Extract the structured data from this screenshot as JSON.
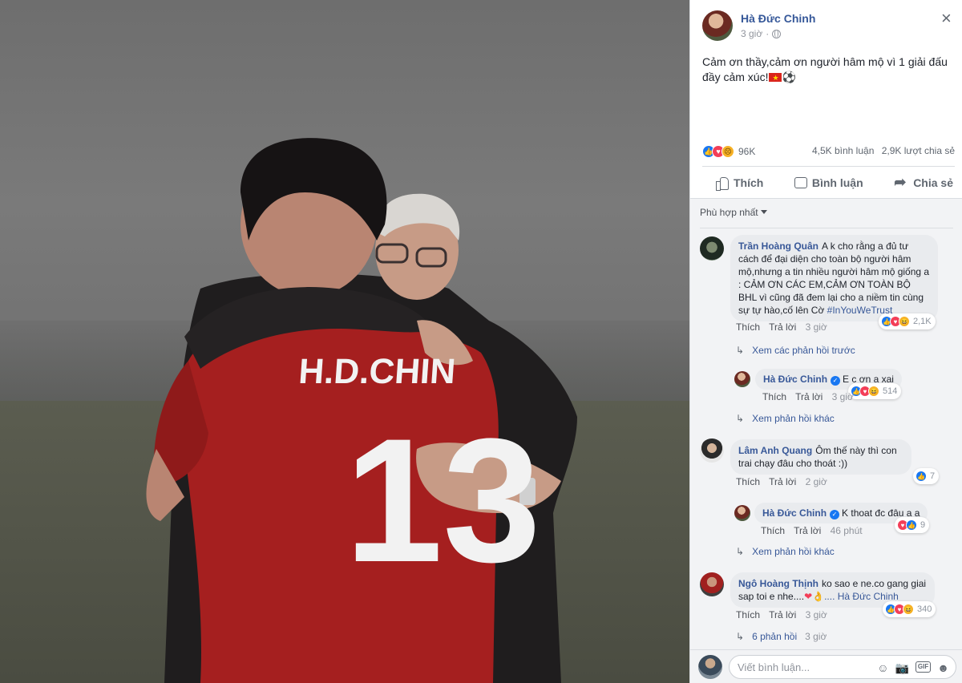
{
  "post": {
    "author": "Hà Đức Chinh",
    "time": "3 giờ",
    "text": "Cảm ơn thầy,cảm ơn người hâm mộ vì 1 giải đấu đầy cảm xúc!",
    "text_emoji_tail": "⚽",
    "reaction_count": "96K",
    "comments_count": "4,5K bình luận",
    "shares_count": "2,9K lượt chia sẻ",
    "actions": {
      "like": "Thích",
      "comment": "Bình luận",
      "share": "Chia sẻ"
    },
    "close_glyph": "×"
  },
  "photo": {
    "jersey_name": "H.D.CHIN",
    "jersey_number": "13"
  },
  "comments": {
    "sort_label": "Phù hợp nhất",
    "items": [
      {
        "name": "Trần Hoàng Quân",
        "text": "A k cho rằng a đủ tư cách để đại diện cho toàn bộ người hâm mộ,nhưng a tin nhiều người hâm mộ giống a : CẢM ƠN CÁC EM,CẢM ƠN TOÀN BỘ BHL vì cũng đã đem lại cho a niềm tin cùng sự tự hào,cố lên Cờ",
        "hashtag": "#InYouWeTrust",
        "like_label": "Thích",
        "reply_label": "Trả lời",
        "time": "3 giờ",
        "reaction_count": "2,1K",
        "more_label": "Xem các phản hồi trước"
      },
      {
        "name": "Hà Đức Chinh",
        "text": "E c ơn a xai",
        "like_label": "Thích",
        "reply_label": "Trả lời",
        "time": "3 giờ",
        "reaction_count": "514",
        "more_label": "Xem phản hồi khác"
      },
      {
        "name": "Lâm Anh Quang",
        "text": "Ôm thế này thì con trai chạy đâu cho thoát :))",
        "like_label": "Thích",
        "reply_label": "Trả lời",
        "time": "2 giờ",
        "reaction_count": "7"
      },
      {
        "name": "Hà Đức Chinh",
        "text": "K thoat đc đâu a a",
        "like_label": "Thích",
        "reply_label": "Trả lời",
        "time": "46 phút",
        "reaction_count": "9",
        "more_label": "Xem phản hồi khác"
      },
      {
        "name": "Ngô Hoàng Thịnh",
        "text": "ko sao e ne.co gang giai sap toi e nhe....",
        "mention": ".... Hà Đức Chinh",
        "like_label": "Thích",
        "reply_label": "Trả lời",
        "time": "3 giờ",
        "reaction_count": "340",
        "replies_label": "6 phản hồi",
        "replies_time": "3 giờ"
      }
    ]
  },
  "composer": {
    "placeholder": "Viết bình luận..."
  },
  "colors": {
    "link": "#365899",
    "like_blue": "#1877f2",
    "love_red": "#f33e58",
    "panel_gray": "#f2f3f5"
  }
}
